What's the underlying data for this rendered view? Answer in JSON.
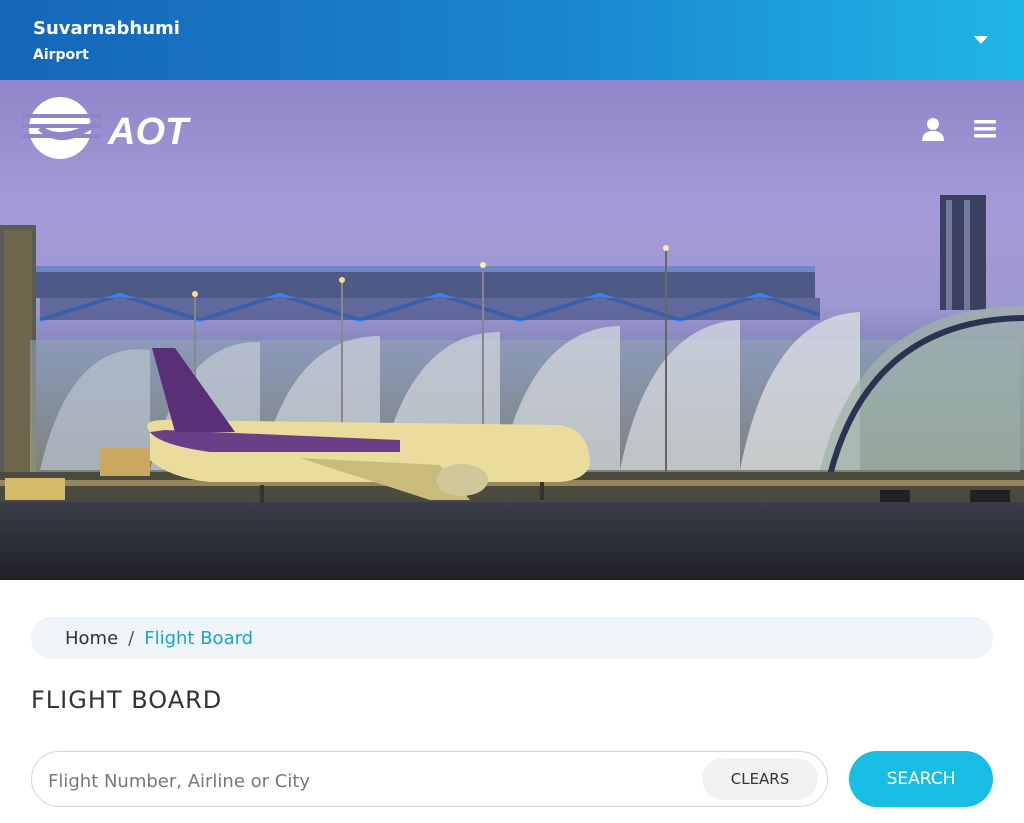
{
  "airport": {
    "name_line1": "Suvarnabhumi",
    "name_line2": "Airport"
  },
  "logo": {
    "text": "AOT"
  },
  "header_icons": [
    "user-icon",
    "menu-icon"
  ],
  "breadcrumb": {
    "home": "Home",
    "separator": "/",
    "current": "Flight Board"
  },
  "page_title": "FLIGHT BOARD",
  "search": {
    "placeholder": "Flight Number, Airline or City",
    "value": "",
    "clear_label": "CLEARS",
    "search_label": "SEARCH"
  },
  "colors": {
    "accent": "#18bde3",
    "link": "#1aa6c9",
    "topbar_start": "#1565b8",
    "topbar_end": "#1fb6e6"
  }
}
